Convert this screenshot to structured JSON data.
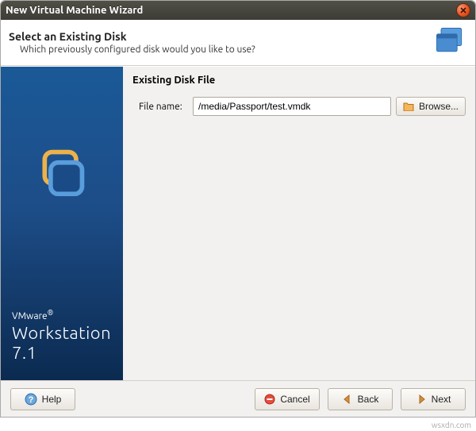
{
  "window": {
    "title": "New Virtual Machine Wizard"
  },
  "header": {
    "heading": "Select an Existing Disk",
    "subheading": "Which previously configured disk would you like to use?"
  },
  "sidebar": {
    "brand_small": "VMware",
    "brand_large": "Workstation 7.1"
  },
  "content": {
    "section_title": "Existing Disk File",
    "filename_label": "File name:",
    "filename_value": "/media/Passport/test.vmdk",
    "browse_label": "Browse..."
  },
  "footer": {
    "help_label": "Help",
    "cancel_label": "Cancel",
    "back_label": "Back",
    "next_label": "Next"
  },
  "watermark": "wsxdn.com"
}
